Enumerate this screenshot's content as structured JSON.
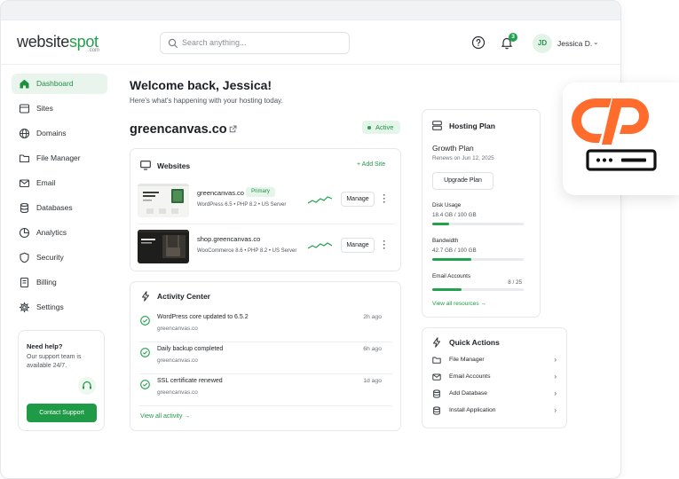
{
  "brand": {
    "name_part1": "website",
    "name_part2": "spot",
    "sub": ".com",
    "accent": "#20a04a"
  },
  "header": {
    "search_placeholder": "Search anything...",
    "notifications_count": "3",
    "user_initials": "JD",
    "user_name": "Jessica D."
  },
  "sidebar": {
    "items": [
      {
        "label": "Dashboard",
        "icon": "home-icon",
        "active": true
      },
      {
        "label": "Sites",
        "icon": "browser-icon"
      },
      {
        "label": "Domains",
        "icon": "globe-icon"
      },
      {
        "label": "File Manager",
        "icon": "folder-icon"
      },
      {
        "label": "Email",
        "icon": "mail-icon"
      },
      {
        "label": "Databases",
        "icon": "database-icon"
      },
      {
        "label": "Analytics",
        "icon": "chart-icon"
      },
      {
        "label": "Security",
        "icon": "shield-icon"
      },
      {
        "label": "Billing",
        "icon": "card-icon"
      },
      {
        "label": "Settings",
        "icon": "gear-icon"
      }
    ],
    "help": {
      "title": "Need help?",
      "desc": "Our support team is available 24/7.",
      "button": "Contact Support"
    }
  },
  "main": {
    "welcome": "Welcome back, Jessica!",
    "subtitle": "Here's what's happening with your hosting today.",
    "domain": "greencanvas.co",
    "status": "Active",
    "websites": {
      "title": "Websites",
      "add_label": "+  Add Site",
      "sites": [
        {
          "name": "greencanvas.co",
          "badge": "Primary",
          "meta": "WordPress 6.5  •  PHP 8.2  •  US Server",
          "action": "Manage"
        },
        {
          "name": "shop.greencanvas.co",
          "meta": "WooCommerce 8.6  •  PHP 8.2  •  US Server",
          "action": "Manage"
        }
      ]
    },
    "activity": {
      "title": "Activity Center",
      "items": [
        {
          "title": "WordPress core updated to 6.5.2",
          "sub": "greencanvas.co",
          "time": "2h ago"
        },
        {
          "title": "Daily backup completed",
          "sub": "greencanvas.co",
          "time": "6h ago"
        },
        {
          "title": "SSL certificate renewed",
          "sub": "greencanvas.co",
          "time": "1d ago"
        }
      ],
      "view_all": "View all activity  →"
    }
  },
  "plan": {
    "title": "Hosting Plan",
    "name": "Growth Plan",
    "renews": "Renews on Jun 12, 2025",
    "upgrade": "Upgrade Plan",
    "usage": [
      {
        "label": "Disk Usage",
        "value": "18.4 GB / 100 GB",
        "percent": 18.4
      },
      {
        "label": "Bandwidth",
        "value": "42.7 GB / 100 GB",
        "percent": 42.7
      },
      {
        "label": "Email Accounts",
        "value": "8 / 25",
        "percent": 32
      }
    ],
    "view_all": "View all resources  →"
  },
  "quick_actions": {
    "title": "Quick Actions",
    "items": [
      {
        "label": "File Manager",
        "icon": "folder-icon"
      },
      {
        "label": "Email Accounts",
        "icon": "mail-icon"
      },
      {
        "label": "Add Database",
        "icon": "database-icon"
      },
      {
        "label": "Install Application",
        "icon": "database-icon"
      }
    ]
  },
  "cpanel": {
    "logo": "cpanel-logo",
    "color": "#ff6c2c"
  }
}
